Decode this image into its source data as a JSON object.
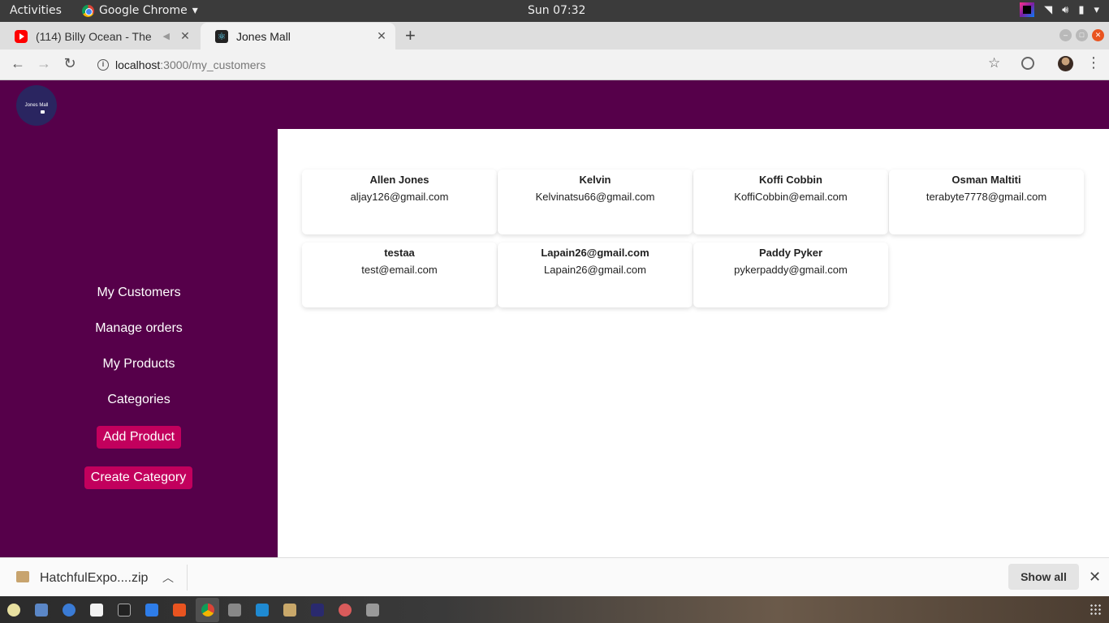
{
  "system_bar": {
    "activities": "Activities",
    "app_menu": "Google Chrome",
    "clock": "Sun 07:32"
  },
  "browser": {
    "tabs": [
      {
        "title": "(114) Billy Ocean - The",
        "icon": "youtube-icon",
        "active": false
      },
      {
        "title": "Jones Mall",
        "icon": "react-icon",
        "active": true
      }
    ],
    "url_host": "localhost",
    "url_path": ":3000/my_customers"
  },
  "app": {
    "logo_text": "Jones Mall",
    "nav": {
      "my_customers": "My Customers",
      "manage_orders": "Manage orders",
      "my_products": "My Products",
      "categories": "Categories"
    },
    "buttons": {
      "add_product": "Add Product",
      "create_category": "Create Category"
    },
    "colors": {
      "brand_purple": "#56004a",
      "button_pink": "#c2005d"
    },
    "customers": [
      {
        "name": "Allen Jones",
        "email": "aljay126@gmail.com"
      },
      {
        "name": "Kelvin",
        "email": "Kelvinatsu66@gmail.com"
      },
      {
        "name": "Koffi Cobbin",
        "email": "KoffiCobbin@email.com"
      },
      {
        "name": "Osman Maltiti",
        "email": "terabyte7778@gmail.com"
      },
      {
        "name": "testaa",
        "email": "test@email.com"
      },
      {
        "name": "Lapain26@gmail.com",
        "email": "Lapain26@gmail.com"
      },
      {
        "name": "Paddy Pyker",
        "email": "pykerpaddy@gmail.com"
      }
    ]
  },
  "downloads": {
    "file_name": "HatchfulExpo....zip",
    "show_all": "Show all"
  }
}
